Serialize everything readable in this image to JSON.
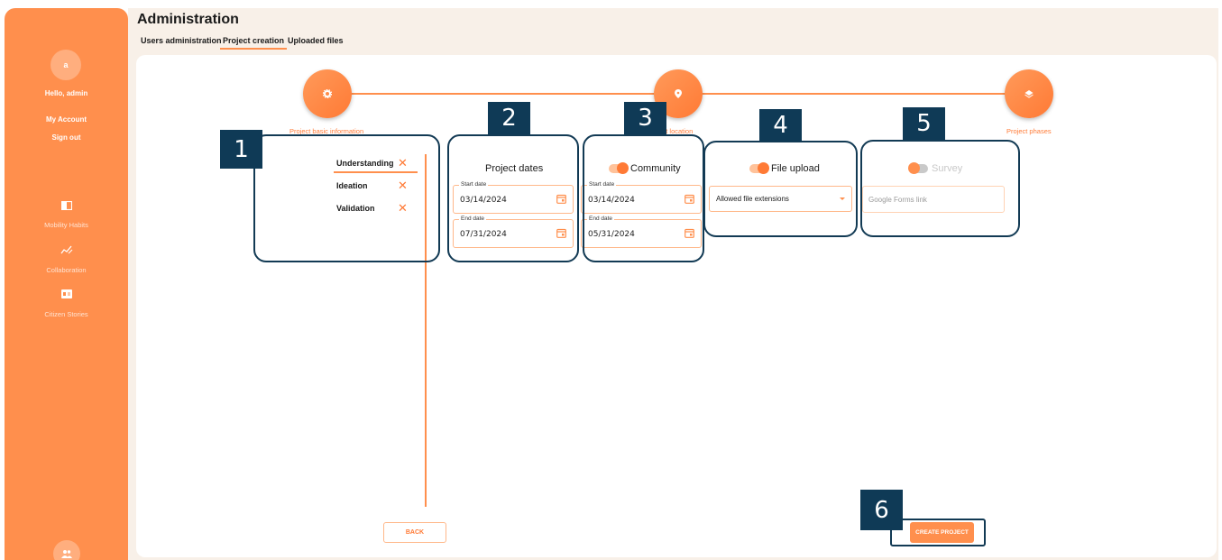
{
  "sidebar": {
    "avatar_initial": "a",
    "greeting": "Hello, admin",
    "my_account": "My Account",
    "sign_out": "Sign out",
    "nav": [
      {
        "label": "Mobility Habits",
        "icon": "book-icon"
      },
      {
        "label": "Collaboration",
        "icon": "chart-icon"
      },
      {
        "label": "Citizen Stories",
        "icon": "id-card-icon"
      }
    ],
    "bottom_icon": "group-icon"
  },
  "header": {
    "title": "Administration",
    "tabs": [
      "Users administration",
      "Project creation",
      "Uploaded files"
    ],
    "active_tab": "Project creation"
  },
  "stepper": {
    "steps": [
      {
        "label": "Project basic information",
        "icon": "gear-icon"
      },
      {
        "label": "Project location",
        "icon": "location-pin-icon"
      },
      {
        "label": "Project phases",
        "icon": "layers-icon"
      }
    ]
  },
  "phases": {
    "items": [
      "Understanding",
      "Ideation",
      "Validation"
    ]
  },
  "project_dates": {
    "title": "Project dates",
    "start_label": "Start date",
    "start_value": "03/14/2024",
    "end_label": "End date",
    "end_value": "07/31/2024"
  },
  "community": {
    "title": "Community",
    "enabled": true,
    "start_label": "Start date",
    "start_value": "03/14/2024",
    "end_label": "End date",
    "end_value": "05/31/2024"
  },
  "file_upload": {
    "title": "File upload",
    "enabled": true,
    "select_value": "Allowed file extensions"
  },
  "survey": {
    "title": "Survey",
    "enabled": false,
    "placeholder": "Google Forms link"
  },
  "buttons": {
    "back": "BACK",
    "create": "CREATE PROJECT"
  },
  "annotations": [
    "1",
    "2",
    "3",
    "4",
    "5",
    "6"
  ],
  "colors": {
    "accent": "#ff8f4d",
    "annotation": "#0f3a56",
    "background": "#f8f0e8"
  }
}
